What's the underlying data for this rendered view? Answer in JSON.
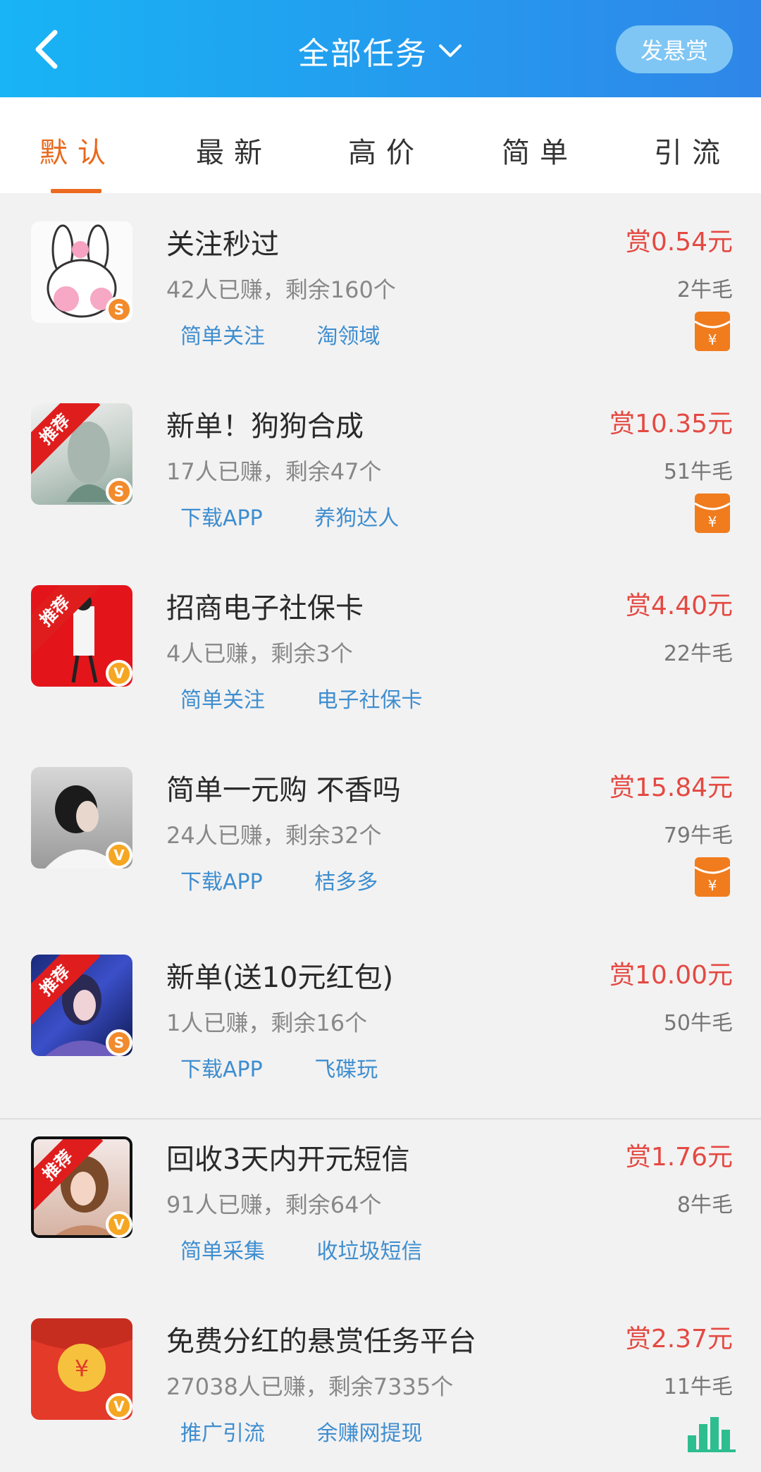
{
  "header": {
    "title": "全部任务",
    "post_button": "发悬赏",
    "back_icon": "back-arrow-icon",
    "dropdown_icon": "chevron-down-icon"
  },
  "tabs": [
    {
      "label": "默认",
      "active": true
    },
    {
      "label": "最新",
      "active": false
    },
    {
      "label": "高价",
      "active": false
    },
    {
      "label": "简单",
      "active": false
    },
    {
      "label": "引流",
      "active": false
    }
  ],
  "tasks": [
    {
      "title": "关注秒过",
      "stats": "42人已赚，剩余160个",
      "reward": "赏0.54元",
      "fur": "2牛毛",
      "tags": [
        "简单关注",
        "淘领域"
      ],
      "badge": "S",
      "recommended": false,
      "icon": "red-envelope-icon"
    },
    {
      "title": "新单！狗狗合成",
      "stats": "17人已赚，剩余47个",
      "reward": "赏10.35元",
      "fur": "51牛毛",
      "tags": [
        "下载APP",
        "养狗达人"
      ],
      "badge": "S",
      "recommended": true,
      "ribbon": "推荐",
      "icon": "red-envelope-icon"
    },
    {
      "title": "招商电子社保卡",
      "stats": "4人已赚，剩余3个",
      "reward": "赏4.40元",
      "fur": "22牛毛",
      "tags": [
        "简单关注",
        "电子社保卡"
      ],
      "badge": "V",
      "recommended": true,
      "ribbon": "推荐",
      "icon": ""
    },
    {
      "title": "简单一元购 不香吗",
      "stats": "24人已赚，剩余32个",
      "reward": "赏15.84元",
      "fur": "79牛毛",
      "tags": [
        "下载APP",
        "桔多多"
      ],
      "badge": "V",
      "recommended": false,
      "icon": "red-envelope-icon"
    },
    {
      "title": "新单(送10元红包)",
      "stats": "1人已赚，剩余16个",
      "reward": "赏10.00元",
      "fur": "50牛毛",
      "tags": [
        "下载APP",
        "飞碟玩"
      ],
      "badge": "S",
      "recommended": true,
      "ribbon": "推荐",
      "icon": ""
    },
    {
      "title": "回收3天内开元短信",
      "stats": "91人已赚，剩余64个",
      "reward": "赏1.76元",
      "fur": "8牛毛",
      "tags": [
        "简单采集",
        "收垃圾短信"
      ],
      "badge": "V",
      "recommended": true,
      "ribbon": "推荐",
      "icon": ""
    },
    {
      "title": "免费分红的悬赏任务平台",
      "stats": "27038人已赚，剩余7335个",
      "reward": "赏2.37元",
      "fur": "11牛毛",
      "tags": [
        "推广引流",
        "余赚网提现"
      ],
      "badge": "V",
      "recommended": false,
      "icon": "bar-chart-icon"
    }
  ],
  "colors": {
    "header_start": "#18b4f5",
    "header_end": "#2f86e8",
    "active_tab": "#e9681c",
    "reward": "#e44942",
    "tag": "#3e8ed0",
    "envelope": "#f07c1e",
    "ribbon": "#e01d1d"
  }
}
